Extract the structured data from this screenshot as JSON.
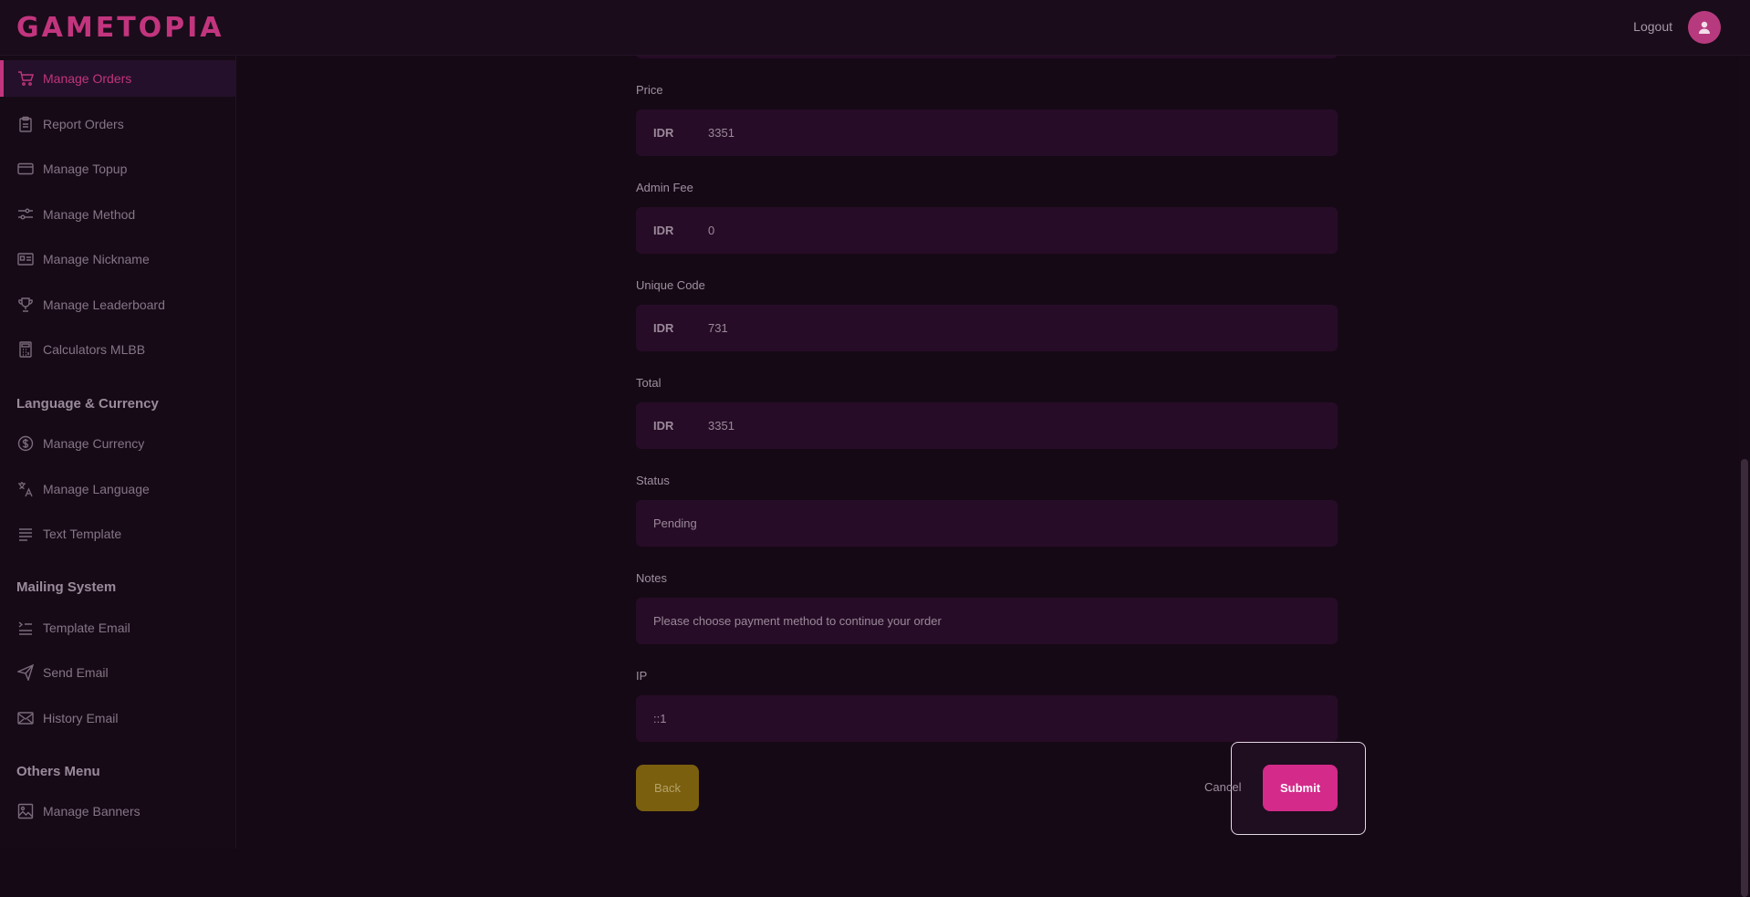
{
  "app": {
    "logo": "GAMETOPIA",
    "logout_label": "Logout"
  },
  "sidebar": {
    "items_main": [
      {
        "label": "Manage Orders",
        "icon": "cart-icon",
        "active": true
      },
      {
        "label": "Report Orders",
        "icon": "clipboard-icon"
      },
      {
        "label": "Manage Topup",
        "icon": "card-icon"
      },
      {
        "label": "Manage Method",
        "icon": "sliders-icon"
      },
      {
        "label": "Manage Nickname",
        "icon": "id-card-icon"
      },
      {
        "label": "Manage Leaderboard",
        "icon": "trophy-icon"
      },
      {
        "label": "Calculators MLBB",
        "icon": "calculator-icon"
      }
    ],
    "section_lang": "Language & Currency",
    "items_lang": [
      {
        "label": "Manage Currency",
        "icon": "dollar-icon"
      },
      {
        "label": "Manage Language",
        "icon": "translate-icon"
      },
      {
        "label": "Text Template",
        "icon": "text-lines-icon"
      }
    ],
    "section_mail": "Mailing System",
    "items_mail": [
      {
        "label": "Template Email",
        "icon": "list-indent-icon"
      },
      {
        "label": "Send Email",
        "icon": "send-icon"
      },
      {
        "label": "History Email",
        "icon": "mail-icon"
      }
    ],
    "section_others": "Others Menu",
    "items_others": [
      {
        "label": "Manage Banners",
        "icon": "image-icon"
      }
    ]
  },
  "form": {
    "price": {
      "label": "Price",
      "prefix": "IDR",
      "value": "3351"
    },
    "admin_fee": {
      "label": "Admin Fee",
      "prefix": "IDR",
      "value": "0"
    },
    "unique_code": {
      "label": "Unique Code",
      "prefix": "IDR",
      "value": "731"
    },
    "total": {
      "label": "Total",
      "prefix": "IDR",
      "value": "3351"
    },
    "status": {
      "label": "Status",
      "value": "Pending"
    },
    "notes": {
      "label": "Notes",
      "value": "Please choose payment method to continue your order"
    },
    "ip": {
      "label": "IP",
      "value": "::1"
    }
  },
  "actions": {
    "back": "Back",
    "cancel": "Cancel",
    "submit": "Submit"
  },
  "colors": {
    "accent": "#c2357e",
    "submit": "#d42a8a",
    "back": "#7a5f0e",
    "field_bg": "#270c27"
  }
}
